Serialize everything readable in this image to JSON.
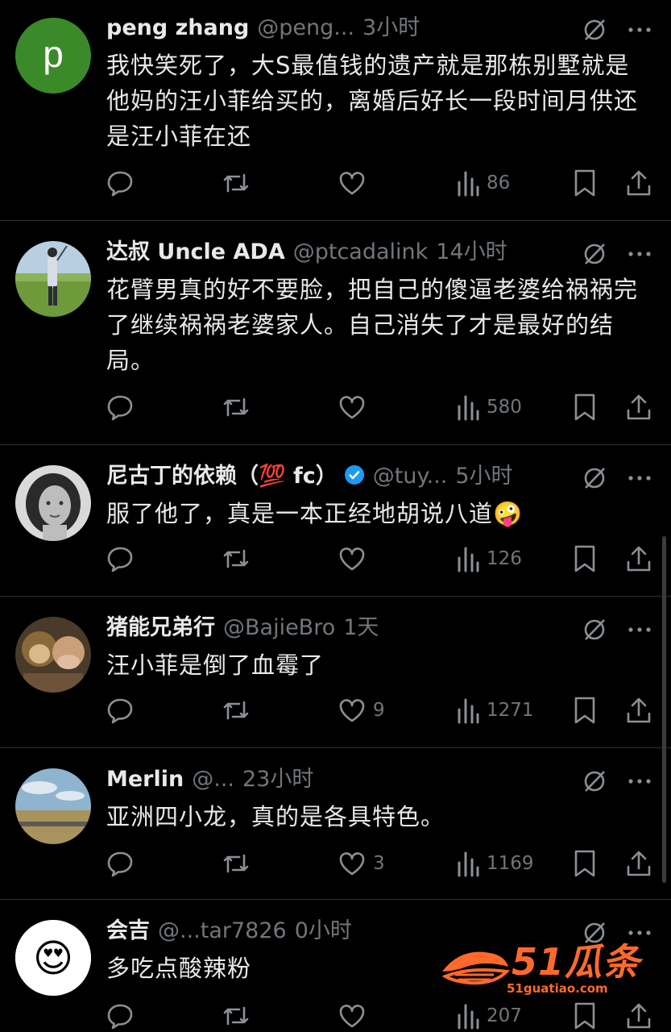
{
  "colors": {
    "background": "#000000",
    "text": "#e7e9ea",
    "muted": "#71767b",
    "divider": "#2f3336",
    "verified": "#1d9bf0",
    "watermark": "#ff6a2a"
  },
  "posts": [
    {
      "name": "peng zhang",
      "handle": "@peng...",
      "time": "3小时",
      "text": "我快笑死了，大S最值钱的遗产就是那栋别墅就是他妈的汪小菲给买的，离婚后好长一段时间月供还是汪小菲在还",
      "likes": "",
      "views": "86",
      "avatar_letter": "p",
      "avatar_color": "#3b8a2a"
    },
    {
      "name": "达叔 Uncle ADA",
      "handle": "@ptcadalink",
      "time": "14小时",
      "text": "花臂男真的好不要脸，把自己的傻逼老婆给祸祸完了继续祸祸老婆家人。自己消失了才是最好的结局。",
      "likes": "",
      "views": "580"
    },
    {
      "name": "尼古丁的依赖（💯 fc）",
      "handle": "@tuy...",
      "time": "5小时",
      "text": "服了他了，真是一本正经地胡说八道🤪",
      "likes": "",
      "views": "126"
    },
    {
      "name": "猪能兄弟行",
      "handle": "@BajieBro",
      "time": "1天",
      "text": "汪小菲是倒了血霉了",
      "likes": "9",
      "views": "1271"
    },
    {
      "name": "Merlin",
      "handle": "@...",
      "time": "23小时",
      "text": "亚洲四小龙，真的是各具特色。",
      "likes": "3",
      "views": "1169"
    },
    {
      "name": "会吉",
      "handle": "@...tar7826",
      "time": "0小时",
      "text": "多吃点酸辣粉",
      "likes": "",
      "views": "207",
      "avatar_emoji": "😍"
    }
  ],
  "watermark": {
    "brand": "51瓜条",
    "url": "51guatiao.com"
  },
  "icons": {
    "reply": "reply-icon",
    "repost": "repost-icon",
    "like": "heart-icon",
    "views": "views-icon",
    "bookmark": "bookmark-icon",
    "share": "share-icon",
    "grok": "grok-icon",
    "more": "more-icon"
  }
}
